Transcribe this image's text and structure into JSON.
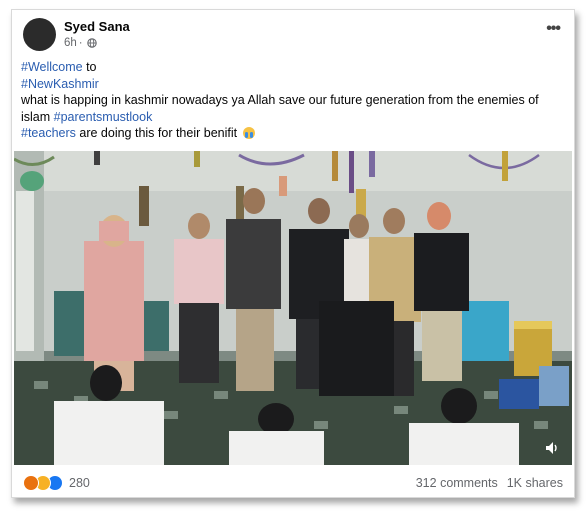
{
  "post": {
    "author": "Syed Sana",
    "time": "6h",
    "separator": "·",
    "privacy_icon": "globe-icon",
    "more_icon": "more-options-icon",
    "text": {
      "line1_hashtag": "#Wellcome",
      "line1_rest": " to",
      "line2_hashtag": "#NewKashmir",
      "line3": "what is happing in kashmir nowadays ya Allah save our future generation from the enemies of islam ",
      "line3_hashtag": "#parentsmustlook",
      "line4_hashtag": "#teachers",
      "line4_rest": " are doing this for their benifit"
    }
  },
  "media": {
    "type": "video-frame",
    "volume_icon": "volume-icon"
  },
  "footer": {
    "reactions": [
      "angry",
      "sad",
      "like"
    ],
    "reaction_count": "280",
    "comments": "312 comments",
    "shares": "1K shares"
  },
  "colors": {
    "hashtag": "#2a5db0",
    "meta": "#65676b",
    "text": "#050505"
  }
}
